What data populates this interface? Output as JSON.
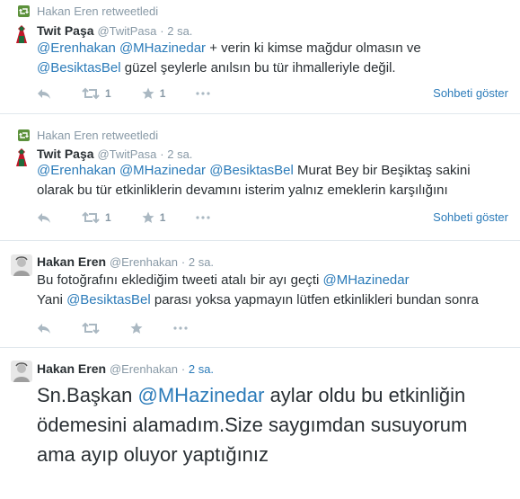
{
  "tweets": [
    {
      "retweeted_by": "Hakan Eren retweetledi",
      "name": "Twit Paşa",
      "handle": "@TwitPasa",
      "time": "2 sa.",
      "lines": [
        [
          {
            "t": "@Erenhakan",
            "m": true
          },
          {
            "t": " ",
            "m": false
          },
          {
            "t": "@MHazinedar",
            "m": true
          },
          {
            "t": "  + verin ki kimse mağdur olmasın ve",
            "m": false
          }
        ],
        [
          {
            "t": "@BesiktasBel",
            "m": true
          },
          {
            "t": " güzel şeylerle anılsın bu tür ihmalleriyle değil.",
            "m": false
          }
        ]
      ],
      "retweet_count": "1",
      "favorite_count": "1",
      "conversation": "Sohbeti göster"
    },
    {
      "retweeted_by": "Hakan Eren retweetledi",
      "name": "Twit Paşa",
      "handle": "@TwitPasa",
      "time": "2 sa.",
      "lines": [
        [
          {
            "t": "@Erenhakan",
            "m": true
          },
          {
            "t": " ",
            "m": false
          },
          {
            "t": "@MHazinedar",
            "m": true
          },
          {
            "t": " ",
            "m": false
          },
          {
            "t": "@BesiktasBel",
            "m": true
          },
          {
            "t": " Murat Bey bir Beşiktaş sakini",
            "m": false
          }
        ],
        [
          {
            "t": "olarak bu tür etkinliklerin devamını isterim yalnız emeklerin karşılığını",
            "m": false
          }
        ]
      ],
      "retweet_count": "1",
      "favorite_count": "1",
      "conversation": "Sohbeti göster"
    },
    {
      "name": "Hakan Eren",
      "handle": "@Erenhakan",
      "time": "2 sa.",
      "lines": [
        [
          {
            "t": "Bu fotoğrafını eklediğim tweeti atalı bir ayı geçti ",
            "m": false
          },
          {
            "t": "@MHazinedar",
            "m": true
          }
        ],
        [
          {
            "t": "Yani ",
            "m": false
          },
          {
            "t": "@BesiktasBel",
            "m": true
          },
          {
            "t": " parası yoksa yapmayın lütfen etkinlikleri bundan sonra",
            "m": false
          }
        ]
      ]
    },
    {
      "name": "Hakan Eren",
      "handle": "@Erenhakan",
      "time": "2 sa.",
      "big_text": [
        {
          "t": "Sn.Başkan ",
          "m": false
        },
        {
          "t": "@MHazinedar",
          "m": true
        },
        {
          "t": " aylar oldu bu etkinliğin ödemesini alamadım.Size saygımdan susuyorum ama ayıp oluyor yaptığınız",
          "m": false
        }
      ]
    }
  ],
  "colors": {
    "mention": "#2b7bb9",
    "meta": "#8899a6",
    "text": "#292f33",
    "retweet_icon": "#5c913b",
    "divider": "#e1e8ed"
  },
  "icons": [
    "retweet-icon",
    "reply-icon",
    "favorite-icon",
    "more-icon"
  ]
}
